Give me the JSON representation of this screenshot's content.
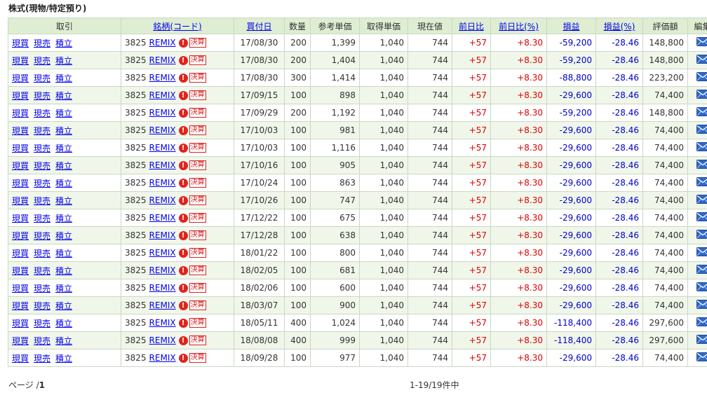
{
  "section_title": "株式(現物/特定預り)",
  "headers": {
    "torihiki": "取引",
    "meigara": "銘柄(コード)",
    "kaitsukebi": "買付日",
    "suryo": "数量",
    "sanko_tanka": "参考単価",
    "shutoku_tanka": "取得単価",
    "genzaine": "現在値",
    "zenjitsuhi": "前日比",
    "zenjitsuhi_pct": "前日比(%)",
    "soneki": "損益",
    "soneki_pct": "損益(%)",
    "hyokagaku": "評価額",
    "henshu": "編集"
  },
  "actions": {
    "buy": "現買",
    "sell": "現売",
    "tsumitate": "積立"
  },
  "badge_icon": "exclamation-icon",
  "badge_text": "決算",
  "edit_icon": "envelope-icon",
  "rows": [
    {
      "code": "3825",
      "name": "REMIX",
      "date": "17/08/30",
      "qty": "200",
      "ref": "1,399",
      "acq": "1,040",
      "cur": "744",
      "chg": "+57",
      "chg_pct": "+8.30",
      "pl": "-59,200",
      "pl_pct": "-28.46",
      "val": "148,800"
    },
    {
      "code": "3825",
      "name": "REMIX",
      "date": "17/08/30",
      "qty": "200",
      "ref": "1,404",
      "acq": "1,040",
      "cur": "744",
      "chg": "+57",
      "chg_pct": "+8.30",
      "pl": "-59,200",
      "pl_pct": "-28.46",
      "val": "148,800"
    },
    {
      "code": "3825",
      "name": "REMIX",
      "date": "17/08/30",
      "qty": "300",
      "ref": "1,414",
      "acq": "1,040",
      "cur": "744",
      "chg": "+57",
      "chg_pct": "+8.30",
      "pl": "-88,800",
      "pl_pct": "-28.46",
      "val": "223,200"
    },
    {
      "code": "3825",
      "name": "REMIX",
      "date": "17/09/15",
      "qty": "100",
      "ref": "898",
      "acq": "1,040",
      "cur": "744",
      "chg": "+57",
      "chg_pct": "+8.30",
      "pl": "-29,600",
      "pl_pct": "-28.46",
      "val": "74,400"
    },
    {
      "code": "3825",
      "name": "REMIX",
      "date": "17/09/29",
      "qty": "200",
      "ref": "1,192",
      "acq": "1,040",
      "cur": "744",
      "chg": "+57",
      "chg_pct": "+8.30",
      "pl": "-59,200",
      "pl_pct": "-28.46",
      "val": "148,800"
    },
    {
      "code": "3825",
      "name": "REMIX",
      "date": "17/10/03",
      "qty": "100",
      "ref": "981",
      "acq": "1,040",
      "cur": "744",
      "chg": "+57",
      "chg_pct": "+8.30",
      "pl": "-29,600",
      "pl_pct": "-28.46",
      "val": "74,400"
    },
    {
      "code": "3825",
      "name": "REMIX",
      "date": "17/10/03",
      "qty": "100",
      "ref": "1,116",
      "acq": "1,040",
      "cur": "744",
      "chg": "+57",
      "chg_pct": "+8.30",
      "pl": "-29,600",
      "pl_pct": "-28.46",
      "val": "74,400"
    },
    {
      "code": "3825",
      "name": "REMIX",
      "date": "17/10/16",
      "qty": "100",
      "ref": "905",
      "acq": "1,040",
      "cur": "744",
      "chg": "+57",
      "chg_pct": "+8.30",
      "pl": "-29,600",
      "pl_pct": "-28.46",
      "val": "74,400"
    },
    {
      "code": "3825",
      "name": "REMIX",
      "date": "17/10/24",
      "qty": "100",
      "ref": "863",
      "acq": "1,040",
      "cur": "744",
      "chg": "+57",
      "chg_pct": "+8.30",
      "pl": "-29,600",
      "pl_pct": "-28.46",
      "val": "74,400"
    },
    {
      "code": "3825",
      "name": "REMIX",
      "date": "17/10/26",
      "qty": "100",
      "ref": "747",
      "acq": "1,040",
      "cur": "744",
      "chg": "+57",
      "chg_pct": "+8.30",
      "pl": "-29,600",
      "pl_pct": "-28.46",
      "val": "74,400"
    },
    {
      "code": "3825",
      "name": "REMIX",
      "date": "17/12/22",
      "qty": "100",
      "ref": "675",
      "acq": "1,040",
      "cur": "744",
      "chg": "+57",
      "chg_pct": "+8.30",
      "pl": "-29,600",
      "pl_pct": "-28.46",
      "val": "74,400"
    },
    {
      "code": "3825",
      "name": "REMIX",
      "date": "17/12/28",
      "qty": "100",
      "ref": "638",
      "acq": "1,040",
      "cur": "744",
      "chg": "+57",
      "chg_pct": "+8.30",
      "pl": "-29,600",
      "pl_pct": "-28.46",
      "val": "74,400"
    },
    {
      "code": "3825",
      "name": "REMIX",
      "date": "18/01/22",
      "qty": "100",
      "ref": "800",
      "acq": "1,040",
      "cur": "744",
      "chg": "+57",
      "chg_pct": "+8.30",
      "pl": "-29,600",
      "pl_pct": "-28.46",
      "val": "74,400"
    },
    {
      "code": "3825",
      "name": "REMIX",
      "date": "18/02/05",
      "qty": "100",
      "ref": "681",
      "acq": "1,040",
      "cur": "744",
      "chg": "+57",
      "chg_pct": "+8.30",
      "pl": "-29,600",
      "pl_pct": "-28.46",
      "val": "74,400"
    },
    {
      "code": "3825",
      "name": "REMIX",
      "date": "18/02/06",
      "qty": "100",
      "ref": "600",
      "acq": "1,040",
      "cur": "744",
      "chg": "+57",
      "chg_pct": "+8.30",
      "pl": "-29,600",
      "pl_pct": "-28.46",
      "val": "74,400"
    },
    {
      "code": "3825",
      "name": "REMIX",
      "date": "18/03/07",
      "qty": "100",
      "ref": "900",
      "acq": "1,040",
      "cur": "744",
      "chg": "+57",
      "chg_pct": "+8.30",
      "pl": "-29,600",
      "pl_pct": "-28.46",
      "val": "74,400"
    },
    {
      "code": "3825",
      "name": "REMIX",
      "date": "18/05/11",
      "qty": "400",
      "ref": "1,024",
      "acq": "1,040",
      "cur": "744",
      "chg": "+57",
      "chg_pct": "+8.30",
      "pl": "-118,400",
      "pl_pct": "-28.46",
      "val": "297,600"
    },
    {
      "code": "3825",
      "name": "REMIX",
      "date": "18/08/08",
      "qty": "400",
      "ref": "999",
      "acq": "1,040",
      "cur": "744",
      "chg": "+57",
      "chg_pct": "+8.30",
      "pl": "-118,400",
      "pl_pct": "-28.46",
      "val": "297,600"
    },
    {
      "code": "3825",
      "name": "REMIX",
      "date": "18/09/28",
      "qty": "100",
      "ref": "977",
      "acq": "1,040",
      "cur": "744",
      "chg": "+57",
      "chg_pct": "+8.30",
      "pl": "-29,600",
      "pl_pct": "-28.46",
      "val": "74,400"
    }
  ],
  "footer": {
    "page_label": "ページ /",
    "page_num": "1",
    "count_text": "1-19/19件中"
  },
  "colors": {
    "header_bg": "#dfeed3",
    "row_alt_bg": "#f0f7ea",
    "border": "#c9d8c0",
    "link": "#0000ee",
    "positive": "#e00000",
    "negative": "#0000cc",
    "badge_red": "#e0241b"
  }
}
